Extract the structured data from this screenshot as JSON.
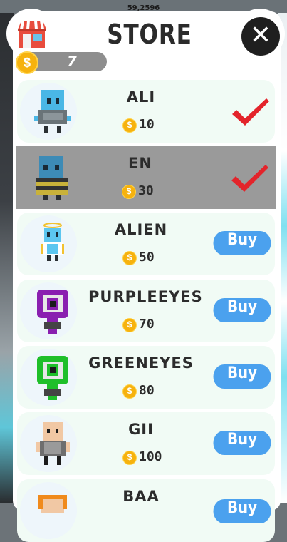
{
  "debug_readout": "59,2596",
  "store": {
    "title": "STORE",
    "coin_balance": "7",
    "coin_glyph": "$",
    "close_glyph": "✕"
  },
  "items": [
    {
      "name": "ALI",
      "price": "10",
      "owned": true,
      "selected": false,
      "action": "",
      "avatar": "blue-robot-icon"
    },
    {
      "name": "EN",
      "price": "30",
      "owned": true,
      "selected": true,
      "action": "",
      "avatar": "blue-striped-robot-icon"
    },
    {
      "name": "ALIEN",
      "price": "50",
      "owned": false,
      "selected": false,
      "action": "Buy",
      "avatar": "alien-angel-icon"
    },
    {
      "name": "PURPLEEYES",
      "price": "70",
      "owned": false,
      "selected": false,
      "action": "Buy",
      "avatar": "purple-eye-monster-icon"
    },
    {
      "name": "GREENEYES",
      "price": "80",
      "owned": false,
      "selected": false,
      "action": "Buy",
      "avatar": "green-eye-monster-icon"
    },
    {
      "name": "GII",
      "price": "100",
      "owned": false,
      "selected": false,
      "action": "Buy",
      "avatar": "bald-man-icon"
    },
    {
      "name": "BAA",
      "price": "",
      "owned": false,
      "selected": false,
      "action": "Buy",
      "avatar": "orange-hair-character-icon"
    }
  ],
  "colors": {
    "buy_button": "#4ba1ee",
    "check": "#e3242b",
    "coin": "#f6b20e",
    "selected_row": "#9a9a9a"
  }
}
